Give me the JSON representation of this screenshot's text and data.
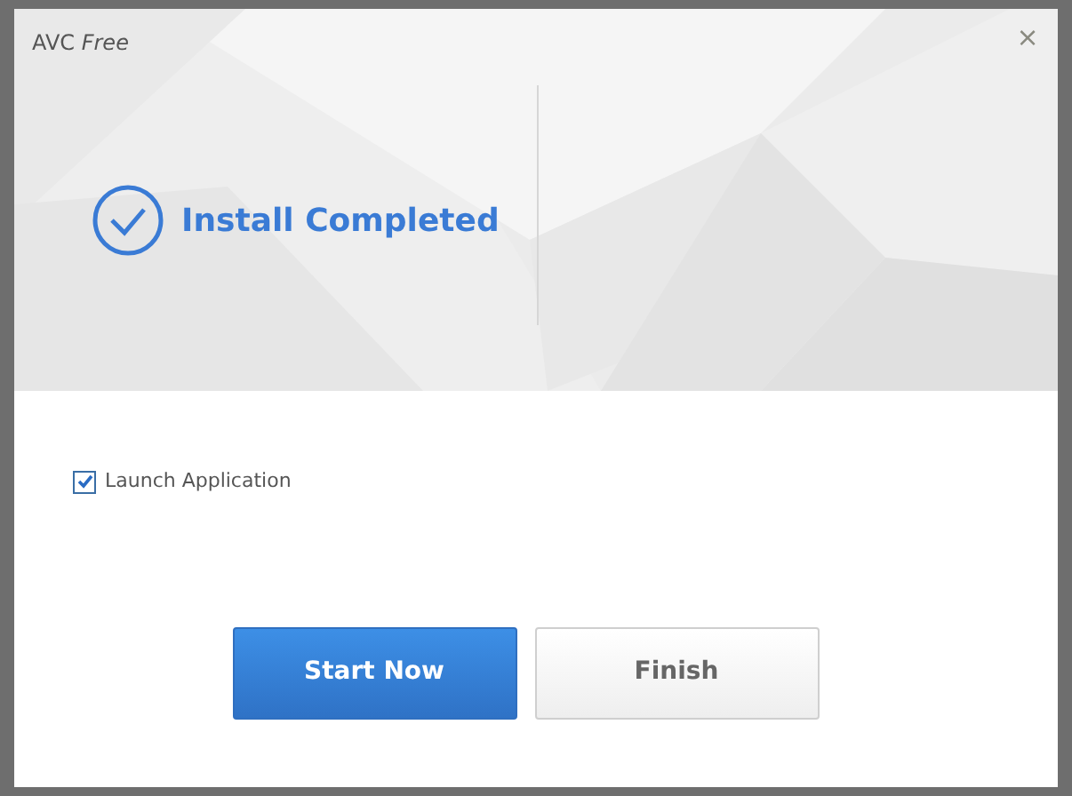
{
  "window": {
    "title": "AVC *Free*",
    "close": "×"
  },
  "banner": {
    "heading": "Install Completed"
  },
  "options": [
    {
      "label": "Launch Application",
      "checked": true
    }
  ],
  "buttons": [
    {
      "label": "Start Now",
      "kind": "primary"
    },
    {
      "label": "Finish",
      "kind": "secondary"
    }
  ]
}
